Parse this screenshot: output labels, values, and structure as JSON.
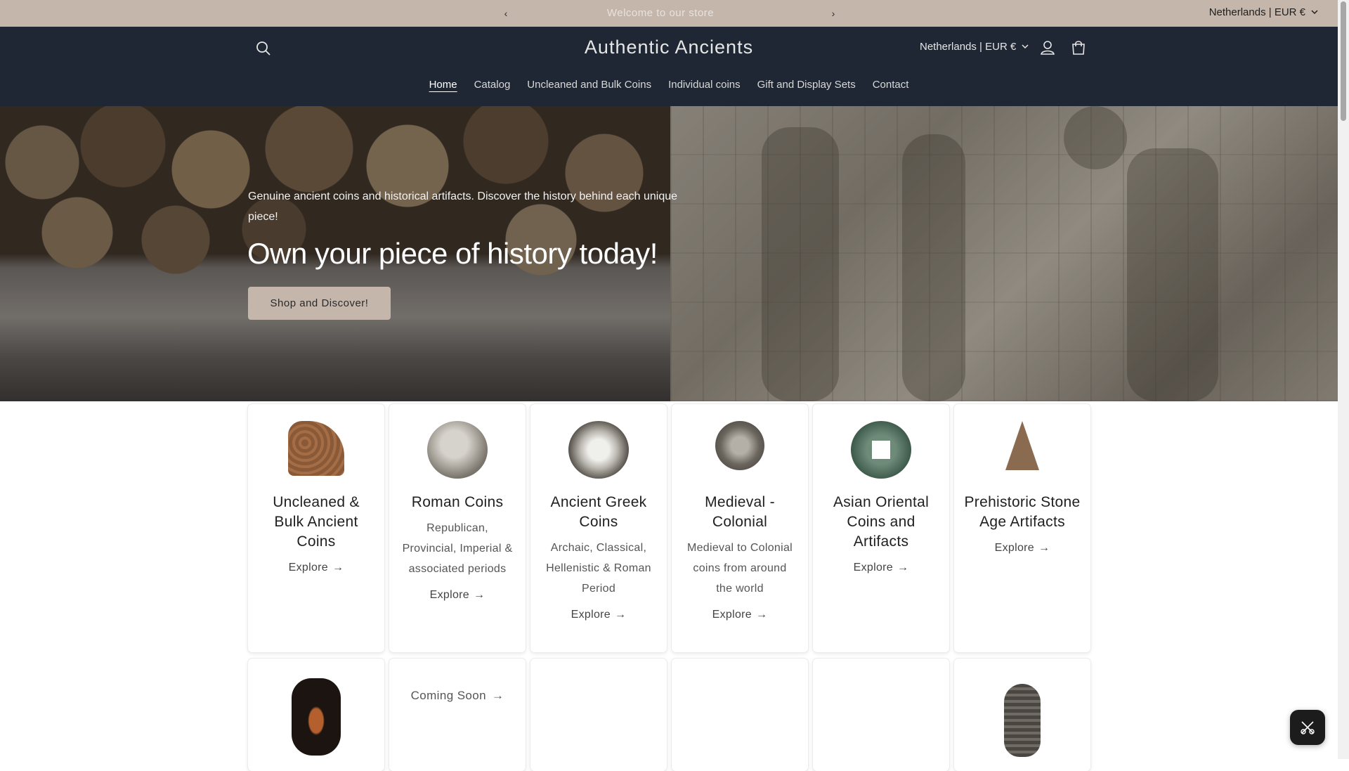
{
  "announcement": {
    "message": "Welcome to our store",
    "locale": "Netherlands | EUR €"
  },
  "header": {
    "logo": "Authentic Ancients",
    "locale": "Netherlands | EUR €"
  },
  "nav": {
    "items": [
      {
        "label": "Home",
        "active": true
      },
      {
        "label": "Catalog"
      },
      {
        "label": "Uncleaned and Bulk Coins"
      },
      {
        "label": "Individual coins"
      },
      {
        "label": "Gift and Display Sets"
      },
      {
        "label": "Contact"
      }
    ]
  },
  "hero": {
    "subtitle": "Genuine ancient coins and historical artifacts. Discover the history behind each unique piece!",
    "title": "Own your piece of history today!",
    "cta": "Shop and Discover!"
  },
  "collections": [
    {
      "title": "Uncleaned & Bulk Ancient Coins",
      "desc": "",
      "link": "Explore",
      "icon": "bulk-coins-image"
    },
    {
      "title": "Roman Coins",
      "desc": "Republican, Provincial, Imperial & associated periods",
      "link": "Explore",
      "icon": "roman-coin-image"
    },
    {
      "title": "Ancient Greek Coins",
      "desc": "Archaic, Classical, Hellenistic & Roman Period",
      "link": "Explore",
      "icon": "greek-owl-coin-image"
    },
    {
      "title": "Medieval - Colonial",
      "desc": "Medieval to Colonial coins from around the world",
      "link": "Explore",
      "icon": "medieval-coin-image"
    },
    {
      "title": "Asian Oriental Coins and Artifacts",
      "desc": "",
      "link": "Explore",
      "icon": "asian-cash-coin-image"
    },
    {
      "title": "Prehistoric Stone Age Artifacts",
      "desc": "",
      "link": "Explore",
      "icon": "arrowhead-image"
    }
  ],
  "row2": {
    "coming_soon": "Coming Soon"
  },
  "colors": {
    "announce_bg": "#c5b6ab",
    "header_bg": "#1e2733",
    "cta_bg": "#c5b6ab"
  }
}
